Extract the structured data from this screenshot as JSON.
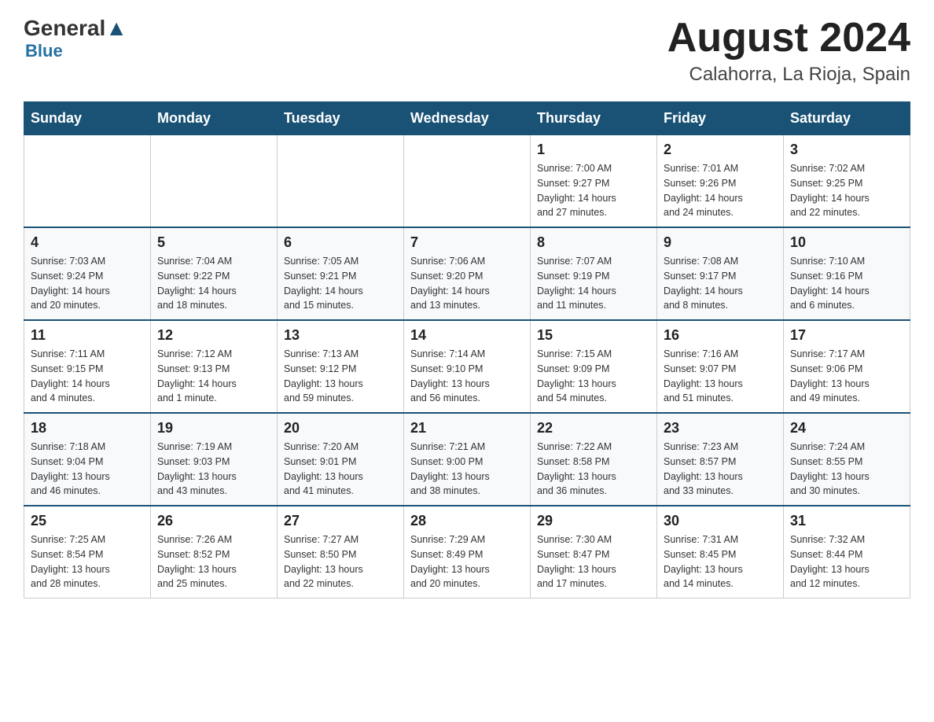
{
  "header": {
    "logo_general": "General",
    "logo_blue": "Blue",
    "month_title": "August 2024",
    "location": "Calahorra, La Rioja, Spain"
  },
  "weekdays": [
    "Sunday",
    "Monday",
    "Tuesday",
    "Wednesday",
    "Thursday",
    "Friday",
    "Saturday"
  ],
  "weeks": [
    [
      {
        "day": "",
        "info": ""
      },
      {
        "day": "",
        "info": ""
      },
      {
        "day": "",
        "info": ""
      },
      {
        "day": "",
        "info": ""
      },
      {
        "day": "1",
        "info": "Sunrise: 7:00 AM\nSunset: 9:27 PM\nDaylight: 14 hours\nand 27 minutes."
      },
      {
        "day": "2",
        "info": "Sunrise: 7:01 AM\nSunset: 9:26 PM\nDaylight: 14 hours\nand 24 minutes."
      },
      {
        "day": "3",
        "info": "Sunrise: 7:02 AM\nSunset: 9:25 PM\nDaylight: 14 hours\nand 22 minutes."
      }
    ],
    [
      {
        "day": "4",
        "info": "Sunrise: 7:03 AM\nSunset: 9:24 PM\nDaylight: 14 hours\nand 20 minutes."
      },
      {
        "day": "5",
        "info": "Sunrise: 7:04 AM\nSunset: 9:22 PM\nDaylight: 14 hours\nand 18 minutes."
      },
      {
        "day": "6",
        "info": "Sunrise: 7:05 AM\nSunset: 9:21 PM\nDaylight: 14 hours\nand 15 minutes."
      },
      {
        "day": "7",
        "info": "Sunrise: 7:06 AM\nSunset: 9:20 PM\nDaylight: 14 hours\nand 13 minutes."
      },
      {
        "day": "8",
        "info": "Sunrise: 7:07 AM\nSunset: 9:19 PM\nDaylight: 14 hours\nand 11 minutes."
      },
      {
        "day": "9",
        "info": "Sunrise: 7:08 AM\nSunset: 9:17 PM\nDaylight: 14 hours\nand 8 minutes."
      },
      {
        "day": "10",
        "info": "Sunrise: 7:10 AM\nSunset: 9:16 PM\nDaylight: 14 hours\nand 6 minutes."
      }
    ],
    [
      {
        "day": "11",
        "info": "Sunrise: 7:11 AM\nSunset: 9:15 PM\nDaylight: 14 hours\nand 4 minutes."
      },
      {
        "day": "12",
        "info": "Sunrise: 7:12 AM\nSunset: 9:13 PM\nDaylight: 14 hours\nand 1 minute."
      },
      {
        "day": "13",
        "info": "Sunrise: 7:13 AM\nSunset: 9:12 PM\nDaylight: 13 hours\nand 59 minutes."
      },
      {
        "day": "14",
        "info": "Sunrise: 7:14 AM\nSunset: 9:10 PM\nDaylight: 13 hours\nand 56 minutes."
      },
      {
        "day": "15",
        "info": "Sunrise: 7:15 AM\nSunset: 9:09 PM\nDaylight: 13 hours\nand 54 minutes."
      },
      {
        "day": "16",
        "info": "Sunrise: 7:16 AM\nSunset: 9:07 PM\nDaylight: 13 hours\nand 51 minutes."
      },
      {
        "day": "17",
        "info": "Sunrise: 7:17 AM\nSunset: 9:06 PM\nDaylight: 13 hours\nand 49 minutes."
      }
    ],
    [
      {
        "day": "18",
        "info": "Sunrise: 7:18 AM\nSunset: 9:04 PM\nDaylight: 13 hours\nand 46 minutes."
      },
      {
        "day": "19",
        "info": "Sunrise: 7:19 AM\nSunset: 9:03 PM\nDaylight: 13 hours\nand 43 minutes."
      },
      {
        "day": "20",
        "info": "Sunrise: 7:20 AM\nSunset: 9:01 PM\nDaylight: 13 hours\nand 41 minutes."
      },
      {
        "day": "21",
        "info": "Sunrise: 7:21 AM\nSunset: 9:00 PM\nDaylight: 13 hours\nand 38 minutes."
      },
      {
        "day": "22",
        "info": "Sunrise: 7:22 AM\nSunset: 8:58 PM\nDaylight: 13 hours\nand 36 minutes."
      },
      {
        "day": "23",
        "info": "Sunrise: 7:23 AM\nSunset: 8:57 PM\nDaylight: 13 hours\nand 33 minutes."
      },
      {
        "day": "24",
        "info": "Sunrise: 7:24 AM\nSunset: 8:55 PM\nDaylight: 13 hours\nand 30 minutes."
      }
    ],
    [
      {
        "day": "25",
        "info": "Sunrise: 7:25 AM\nSunset: 8:54 PM\nDaylight: 13 hours\nand 28 minutes."
      },
      {
        "day": "26",
        "info": "Sunrise: 7:26 AM\nSunset: 8:52 PM\nDaylight: 13 hours\nand 25 minutes."
      },
      {
        "day": "27",
        "info": "Sunrise: 7:27 AM\nSunset: 8:50 PM\nDaylight: 13 hours\nand 22 minutes."
      },
      {
        "day": "28",
        "info": "Sunrise: 7:29 AM\nSunset: 8:49 PM\nDaylight: 13 hours\nand 20 minutes."
      },
      {
        "day": "29",
        "info": "Sunrise: 7:30 AM\nSunset: 8:47 PM\nDaylight: 13 hours\nand 17 minutes."
      },
      {
        "day": "30",
        "info": "Sunrise: 7:31 AM\nSunset: 8:45 PM\nDaylight: 13 hours\nand 14 minutes."
      },
      {
        "day": "31",
        "info": "Sunrise: 7:32 AM\nSunset: 8:44 PM\nDaylight: 13 hours\nand 12 minutes."
      }
    ]
  ]
}
